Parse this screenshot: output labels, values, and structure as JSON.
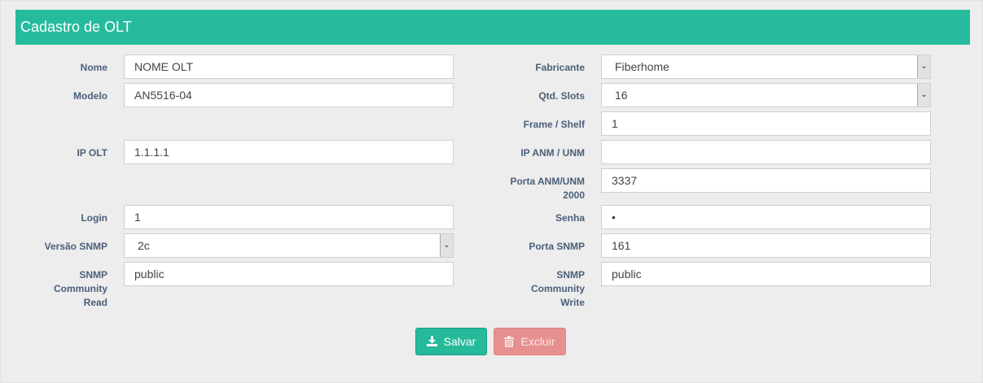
{
  "header": {
    "title": "Cadastro de OLT"
  },
  "form": {
    "nome": {
      "label": "Nome",
      "value": "NOME OLT"
    },
    "modelo": {
      "label": "Modelo",
      "value": "AN5516-04"
    },
    "ip_olt": {
      "label": "IP OLT",
      "value": "1.1.1.1"
    },
    "login": {
      "label": "Login",
      "value": "1"
    },
    "versao_snmp": {
      "label": "Versão SNMP",
      "value": "2c"
    },
    "snmp_read": {
      "label_lines": [
        "SNMP",
        "Community",
        "Read"
      ],
      "value": "public"
    },
    "fabricante": {
      "label": "Fabricante",
      "value": "Fiberhome"
    },
    "qtd_slots": {
      "label": "Qtd. Slots",
      "value": "16"
    },
    "frame_shelf": {
      "label": "Frame / Shelf",
      "value": "1"
    },
    "ip_anm": {
      "label": "IP ANM / UNM",
      "value": ""
    },
    "porta_anm": {
      "label_lines": [
        "Porta ANM/UNM",
        "2000"
      ],
      "value": "3337"
    },
    "senha": {
      "label": "Senha",
      "value": "•"
    },
    "porta_snmp": {
      "label": "Porta SNMP",
      "value": "161"
    },
    "snmp_write": {
      "label_lines": [
        "SNMP",
        "Community",
        "Write"
      ],
      "value": "public"
    }
  },
  "buttons": {
    "save_label": "Salvar",
    "delete_label": "Excluir"
  },
  "icons": {
    "save": "download-icon",
    "delete": "trash-icon",
    "select_arrow": "chevron-down-icon"
  },
  "colors": {
    "header": "#26bb9c",
    "save_button": "#26b99a",
    "delete_button": "#e6908f",
    "label": "#4a5f7a"
  }
}
